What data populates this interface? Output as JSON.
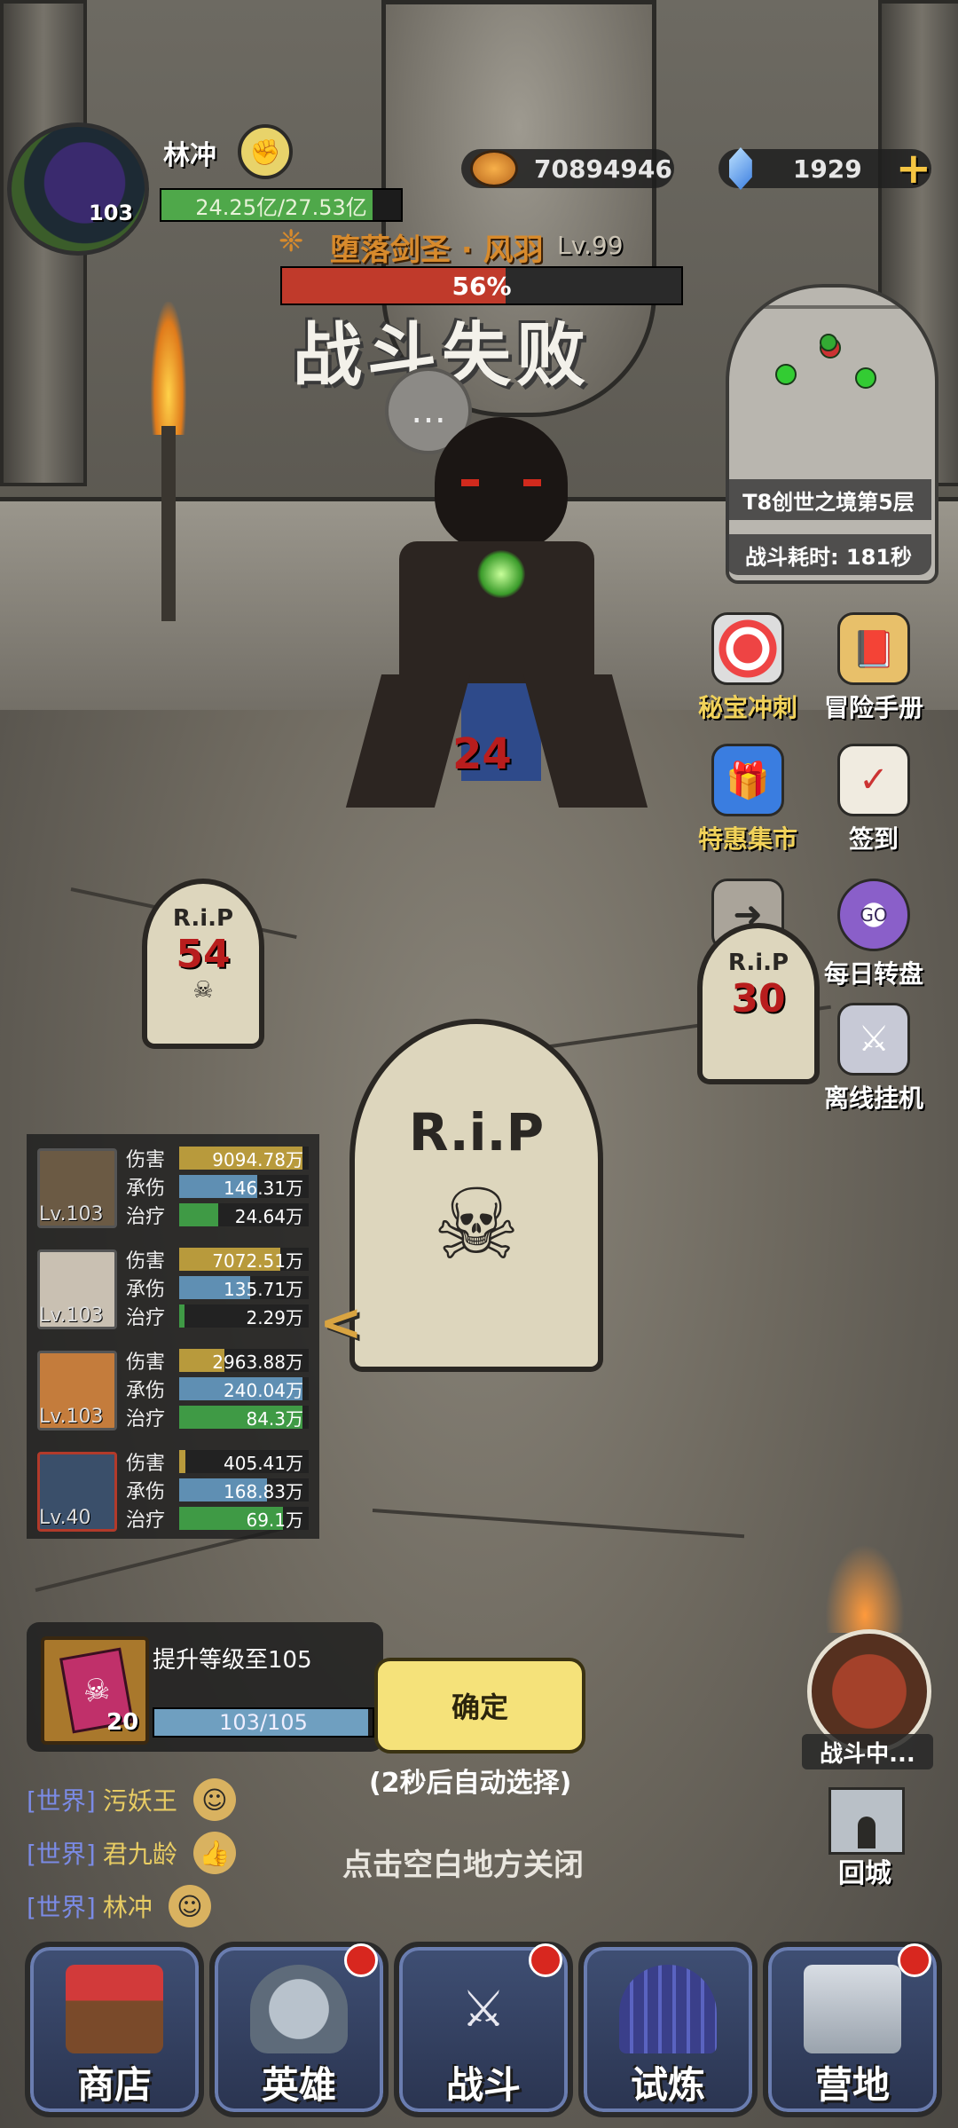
{
  "player": {
    "name": "林冲",
    "level": "103",
    "exp_text": "24.25亿/27.53亿",
    "exp_ratio": 0.88
  },
  "resources": {
    "gold": "70894946",
    "gems": "1929"
  },
  "boss": {
    "name": "堕落剑圣 · 风羽",
    "level": "Lv.99",
    "hp_text": "56%",
    "hp_ratio": 0.56
  },
  "battle": {
    "result_title": "战斗失败"
  },
  "minimap": {
    "stage": "T8创世之境第5层",
    "time": "战斗耗时: 181秒"
  },
  "side_menu": {
    "treasure": "秘宝冲刺",
    "adventure_book": "冒险手册",
    "special_market": "特惠集市",
    "sign_in": "签到",
    "collapse": "收起",
    "daily_wheel": "每日转盘",
    "offline_idle": "离线挂机"
  },
  "damage": {
    "enemy_hit": "24",
    "tomb_left": "54",
    "tomb_right": "30"
  },
  "tomb_text": "R.i.P",
  "heroes": [
    {
      "level": "Lv.103",
      "damage": "9094.78万",
      "taken": "146.31万",
      "heal": "24.64万",
      "d": 0.95,
      "t": 0.6,
      "h": 0.3
    },
    {
      "level": "Lv.103",
      "damage": "7072.51万",
      "taken": "135.71万",
      "heal": "2.29万",
      "d": 0.78,
      "t": 0.55,
      "h": 0.04
    },
    {
      "level": "Lv.103",
      "damage": "2963.88万",
      "taken": "240.04万",
      "heal": "84.3万",
      "d": 0.35,
      "t": 0.95,
      "h": 0.95
    },
    {
      "level": "Lv.40",
      "damage": "405.41万",
      "taken": "168.83万",
      "heal": "69.1万",
      "d": 0.05,
      "t": 0.68,
      "h": 0.8
    }
  ],
  "stat_labels": {
    "damage": "伤害",
    "taken": "承伤",
    "heal": "治疗"
  },
  "quest": {
    "title": "提升等级至105",
    "count": "20",
    "progress_text": "103/105",
    "progress_ratio": 0.98
  },
  "confirm": {
    "label": "确定",
    "note": "(2秒后自动选择)"
  },
  "close_hint": "点击空白地方关闭",
  "chat": [
    {
      "tag": "[世界]",
      "name": "污妖王"
    },
    {
      "tag": "[世界]",
      "name": "君九龄"
    },
    {
      "tag": "[世界]",
      "name": "林冲"
    }
  ],
  "fighting_label": "战斗中...",
  "return_label": "回城",
  "nav": [
    {
      "label": "商店",
      "badge": false
    },
    {
      "label": "英雄",
      "badge": true
    },
    {
      "label": "战斗",
      "badge": true
    },
    {
      "label": "试炼",
      "badge": false
    },
    {
      "label": "营地",
      "badge": true
    }
  ],
  "colors": {
    "damage_bar": "#b89a3c",
    "taken_bar": "#5f8fb3",
    "heal_bar": "#3f9a45",
    "boss_name": "#d78a2c",
    "confirm": "#f5e27a"
  }
}
